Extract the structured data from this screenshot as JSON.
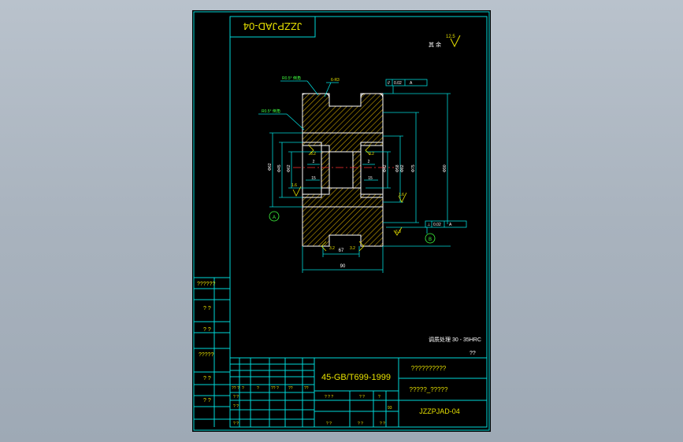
{
  "drawing": {
    "number_mirrored": "JZZPJAD-04",
    "number": "JZZPJAD-04",
    "material": "45-GB/T699-1999",
    "part_name": "??????????",
    "spec": "?????_?????",
    "heat_treatment": "调质处理 30 - 35HRC",
    "tech_req_mark": "其 余",
    "surface_other": "12.5"
  },
  "left_strip": {
    "labels": [
      "??????",
      "? ?",
      "? ?",
      "?????",
      "? ?",
      "? ?"
    ]
  },
  "title_block": {
    "rows": {
      "r1": [
        "?? ?",
        "?",
        "?",
        "?? ?",
        "??",
        "??"
      ],
      "r2": [
        "? ?",
        "",
        "",
        "? ? ?",
        "? ?",
        "?"
      ],
      "r3": [
        "? ?",
        "",
        "",
        "",
        "",
        "93"
      ],
      "r4": [
        "? ?",
        "",
        "",
        "? ?",
        "? ?",
        "? ?"
      ]
    },
    "weight_col": "??"
  },
  "annotations": {
    "chamfer_1": "R0.5° 倒角",
    "chamfer_2": "R0.5° 倒角",
    "chamfer_size": "6-R3",
    "datum_a": "A",
    "datum_b": "B",
    "tol_top": [
      "//",
      "0.02",
      "A"
    ],
    "tol_bottom": [
      "⊥",
      "0.02",
      "A"
    ],
    "rough_1": "3.2",
    "rough_2": "3.2",
    "rough_3": "1.6",
    "rough_4": "1.6",
    "rough_5": "3.2",
    "rough_6": "3.2",
    "rough_7": "6.3",
    "dim_width": "90",
    "dim_hub": "67",
    "dim_15a": "15",
    "dim_15b": "15",
    "dim_2a": "2",
    "dim_2b": "2",
    "dim_d1": "Φ62",
    "dim_d2": "Φ45",
    "dim_d3": "Φ62",
    "dim_d4": "Φ58",
    "dim_d5": "Φ75",
    "dim_d6": "Φ90",
    "dim_d7": "Φ42",
    "dim_d8": "Φ82"
  },
  "colors": {
    "frame": "#00d8d8",
    "line": "#ffffff",
    "hatch": "#c8a000",
    "text_yellow": "#e6e000",
    "text_green": "#40ff40",
    "center": "#ff3030"
  }
}
